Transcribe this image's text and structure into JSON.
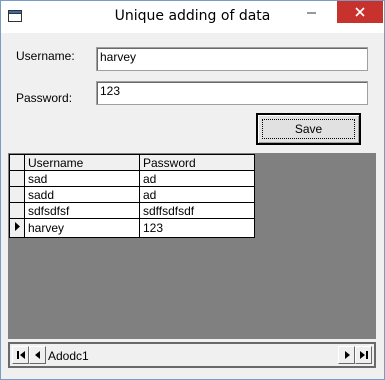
{
  "window": {
    "title": "Unique adding of data"
  },
  "form": {
    "username_label": "Username:",
    "username_value": "harvey",
    "password_label": "Password:",
    "password_value": "123",
    "save_label": "Save"
  },
  "grid": {
    "columns": [
      "Username",
      "Password"
    ],
    "rows": [
      {
        "username": "sad",
        "password": "ad",
        "current": false
      },
      {
        "username": "sadd",
        "password": "ad",
        "current": false
      },
      {
        "username": "sdfsdfsf",
        "password": "sdffsdfsdf",
        "current": false
      },
      {
        "username": "harvey",
        "password": "123",
        "current": true
      }
    ]
  },
  "adodc": {
    "caption": "Adodc1"
  },
  "colors": {
    "close_button": "#c7322c",
    "window_border": "#7a9cc4"
  },
  "icons": [
    "app-icon",
    "minimize-icon",
    "maximize-icon",
    "close-icon",
    "move-first-icon",
    "move-previous-icon",
    "move-next-icon",
    "move-last-icon",
    "current-row-icon"
  ]
}
